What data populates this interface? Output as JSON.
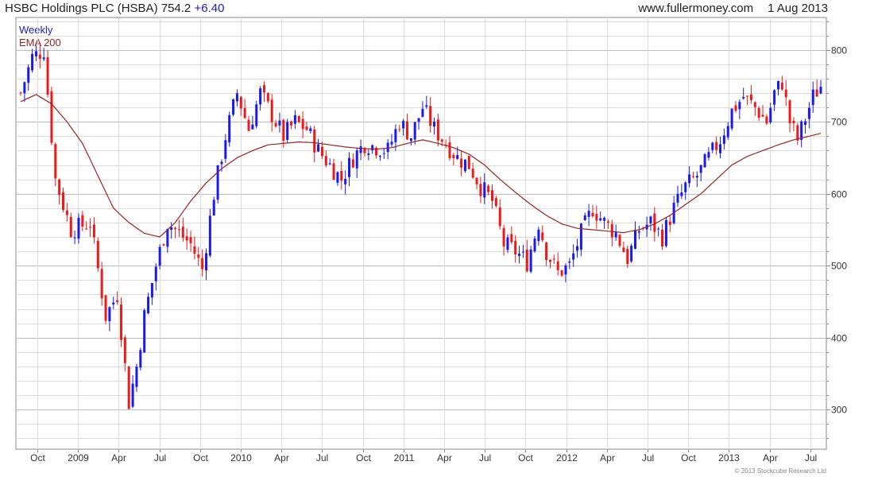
{
  "header": {
    "title": "HSBC Holdings PLC (HSBA)",
    "price": "754.2",
    "change": "+6.40",
    "site": "www.fullermoney.com",
    "date": "1 Aug 2013"
  },
  "legend": {
    "weekly": "Weekly",
    "ema": "EMA 200"
  },
  "copyright": "© 2013 Stockcube Research Ltd",
  "colors": {
    "up": "#1a1aee",
    "down": "#ee1a1a",
    "ema": "#9a2222",
    "grid": "#dddddd",
    "axis": "#888888"
  },
  "chart_data": {
    "type": "candlestick",
    "title": "HSBC Holdings PLC (HSBA)",
    "interval": "Weekly",
    "overlay": "EMA 200",
    "ylim": [
      245,
      845
    ],
    "y_ticks": [
      300,
      400,
      500,
      600,
      700,
      800
    ],
    "x_ticks": [
      "Oct",
      "2009",
      "Apr",
      "Jul",
      "Oct",
      "2010",
      "Apr",
      "Jul",
      "Oct",
      "2011",
      "Apr",
      "Jul",
      "Oct",
      "2012",
      "Apr",
      "Jul",
      "Oct",
      "2013",
      "Apr",
      "Jul"
    ],
    "grid": true,
    "ohlc_keypoints": [
      [
        0,
        740
      ],
      [
        3,
        790
      ],
      [
        6,
        800
      ],
      [
        9,
        620
      ],
      [
        13,
        550
      ],
      [
        18,
        560
      ],
      [
        22,
        430
      ],
      [
        25,
        460
      ],
      [
        28,
        310
      ],
      [
        30,
        360
      ],
      [
        32,
        430
      ],
      [
        35,
        500
      ],
      [
        38,
        560
      ],
      [
        41,
        545
      ],
      [
        44,
        530
      ],
      [
        47,
        495
      ],
      [
        50,
        600
      ],
      [
        53,
        680
      ],
      [
        56,
        740
      ],
      [
        59,
        690
      ],
      [
        62,
        740
      ],
      [
        65,
        710
      ],
      [
        68,
        680
      ],
      [
        71,
        700
      ],
      [
        74,
        690
      ],
      [
        77,
        660
      ],
      [
        80,
        640
      ],
      [
        83,
        620
      ],
      [
        86,
        650
      ],
      [
        89,
        670
      ],
      [
        92,
        665
      ],
      [
        95,
        660
      ],
      [
        98,
        700
      ],
      [
        101,
        680
      ],
      [
        104,
        720
      ],
      [
        107,
        690
      ],
      [
        110,
        670
      ],
      [
        113,
        650
      ],
      [
        116,
        640
      ],
      [
        119,
        610
      ],
      [
        122,
        590
      ],
      [
        125,
        530
      ],
      [
        128,
        520
      ],
      [
        131,
        505
      ],
      [
        134,
        560
      ],
      [
        136,
        520
      ],
      [
        139,
        490
      ],
      [
        142,
        500
      ],
      [
        145,
        545
      ],
      [
        148,
        580
      ],
      [
        151,
        560
      ],
      [
        154,
        545
      ],
      [
        157,
        510
      ],
      [
        160,
        550
      ],
      [
        163,
        560
      ],
      [
        166,
        540
      ],
      [
        169,
        580
      ],
      [
        172,
        610
      ],
      [
        175,
        625
      ],
      [
        178,
        650
      ],
      [
        181,
        675
      ],
      [
        184,
        715
      ],
      [
        187,
        735
      ],
      [
        190,
        720
      ],
      [
        193,
        700
      ],
      [
        195,
        740
      ],
      [
        197,
        755
      ],
      [
        199,
        700
      ],
      [
        201,
        675
      ],
      [
        203,
        705
      ],
      [
        205,
        735
      ],
      [
        207,
        750
      ]
    ],
    "ema_keypoints": [
      [
        0,
        728
      ],
      [
        4,
        738
      ],
      [
        8,
        725
      ],
      [
        12,
        700
      ],
      [
        16,
        670
      ],
      [
        20,
        625
      ],
      [
        24,
        580
      ],
      [
        28,
        560
      ],
      [
        32,
        545
      ],
      [
        36,
        540
      ],
      [
        40,
        560
      ],
      [
        44,
        590
      ],
      [
        48,
        615
      ],
      [
        52,
        635
      ],
      [
        56,
        650
      ],
      [
        60,
        660
      ],
      [
        64,
        668
      ],
      [
        68,
        670
      ],
      [
        72,
        672
      ],
      [
        76,
        671
      ],
      [
        80,
        668
      ],
      [
        84,
        665
      ],
      [
        88,
        663
      ],
      [
        92,
        662
      ],
      [
        96,
        664
      ],
      [
        100,
        670
      ],
      [
        104,
        675
      ],
      [
        108,
        670
      ],
      [
        112,
        664
      ],
      [
        116,
        655
      ],
      [
        120,
        640
      ],
      [
        124,
        620
      ],
      [
        128,
        602
      ],
      [
        132,
        585
      ],
      [
        136,
        570
      ],
      [
        140,
        558
      ],
      [
        144,
        552
      ],
      [
        148,
        550
      ],
      [
        152,
        548
      ],
      [
        156,
        546
      ],
      [
        160,
        550
      ],
      [
        164,
        558
      ],
      [
        168,
        570
      ],
      [
        172,
        585
      ],
      [
        176,
        600
      ],
      [
        180,
        620
      ],
      [
        184,
        640
      ],
      [
        188,
        652
      ],
      [
        192,
        660
      ],
      [
        196,
        668
      ],
      [
        200,
        675
      ],
      [
        204,
        680
      ],
      [
        207,
        684
      ]
    ]
  }
}
